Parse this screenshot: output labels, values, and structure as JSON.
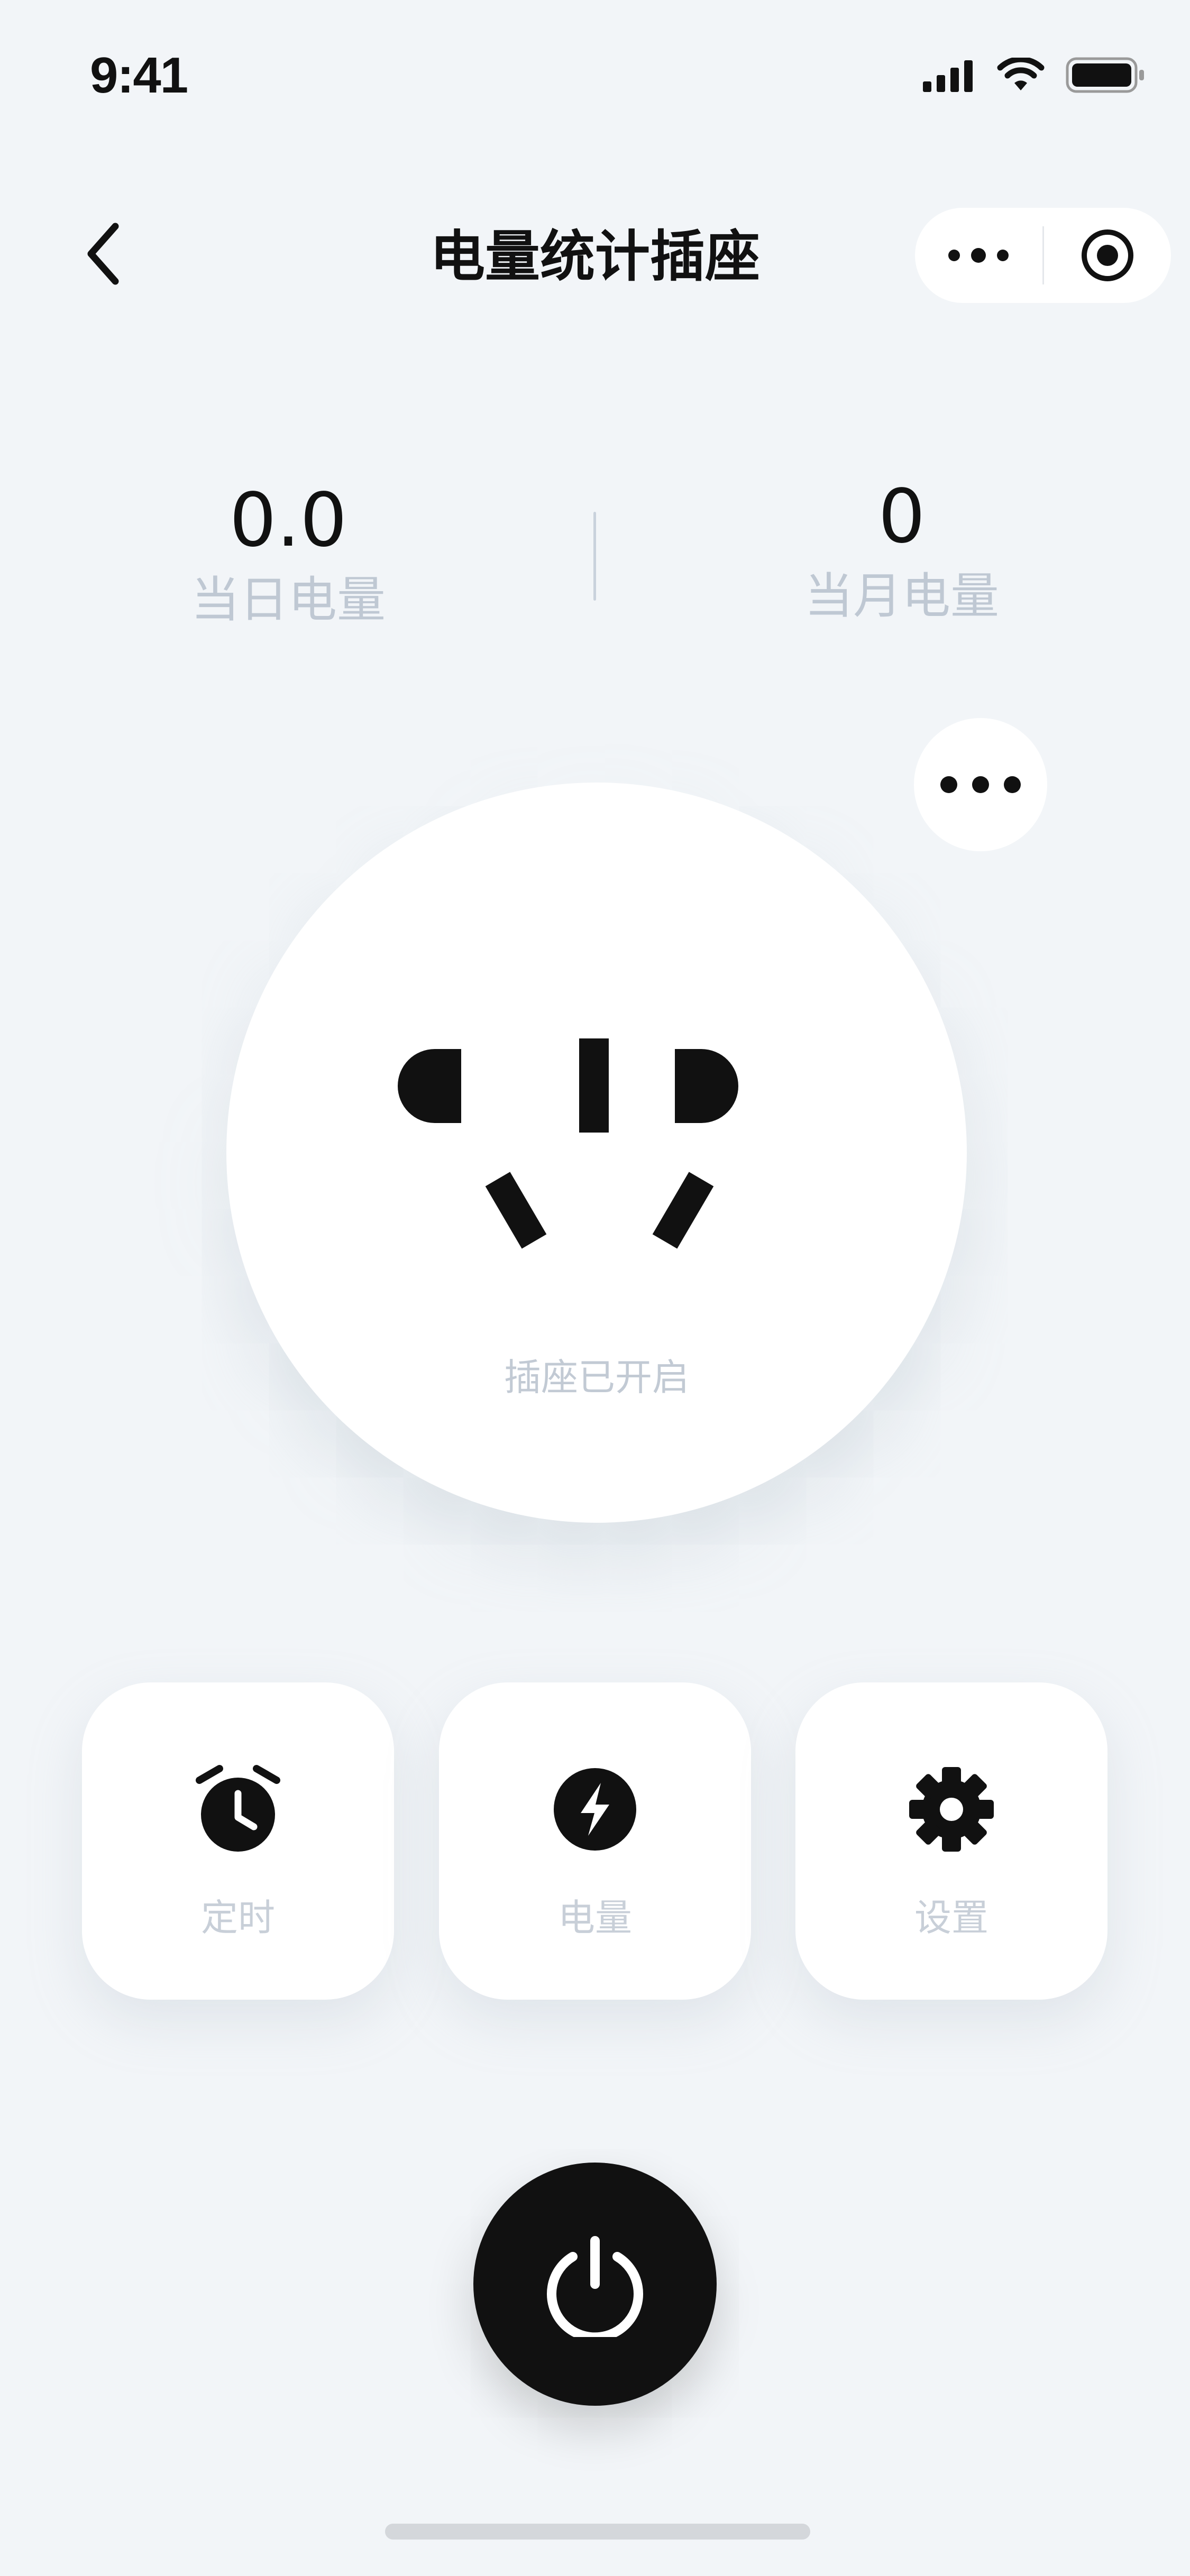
{
  "status_bar": {
    "time": "9:41"
  },
  "nav": {
    "title": "电量统计插座"
  },
  "stats": {
    "daily": {
      "value": "0.0",
      "label": "当日电量"
    },
    "monthly": {
      "value": "0",
      "label": "当月电量"
    }
  },
  "socket": {
    "status_text": "插座已开启"
  },
  "actions": [
    {
      "label": "定时",
      "icon": "alarm-clock-icon"
    },
    {
      "label": "电量",
      "icon": "lightning-icon"
    },
    {
      "label": "设置",
      "icon": "gear-icon"
    }
  ],
  "colors": {
    "background": "#F2F5F8",
    "surface": "#FFFFFF",
    "primary": "#111111",
    "muted_text": "#BFC8D3"
  }
}
